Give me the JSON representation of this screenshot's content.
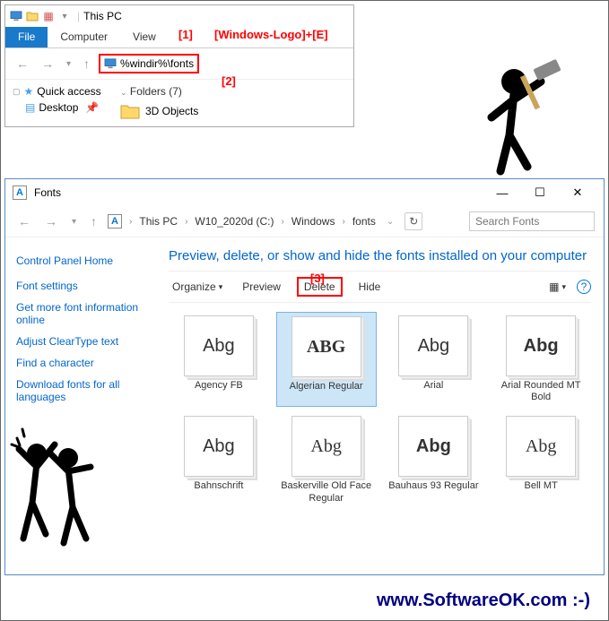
{
  "topWindow": {
    "title": "This PC",
    "fileTab": "File",
    "tabs": [
      "Computer",
      "View"
    ],
    "addressValue": "%windir%\\fonts",
    "quickAccess": "Quick access",
    "desktop": "Desktop",
    "foldersHeader": "Folders (7)",
    "folderItem": "3D Objects"
  },
  "annotations": {
    "a1_num": "[1]",
    "a1_text": "[Windows-Logo]+[E]",
    "a2": "[2]",
    "a3": "[3]"
  },
  "fontsWindow": {
    "title": "Fonts",
    "breadcrumb": [
      "This PC",
      "W10_2020d (C:)",
      "Windows",
      "fonts"
    ],
    "searchPlaceholder": "Search Fonts",
    "sidebar": {
      "home": "Control Panel Home",
      "links": [
        "Font settings",
        "Get more font information online",
        "Adjust ClearType text",
        "Find a character",
        "Download fonts for all languages"
      ]
    },
    "heading": "Preview, delete, or show and hide the fonts installed on your computer",
    "toolbar": {
      "organize": "Organize",
      "preview": "Preview",
      "delete": "Delete",
      "hide": "Hide"
    },
    "fonts": [
      {
        "name": "Agency FB",
        "sample": "Abg",
        "style": "font-family:'Agency FB',sans-serif;font-stretch:condensed"
      },
      {
        "name": "Algerian Regular",
        "sample": "ABG",
        "style": "font-family:'Algerian',serif;font-weight:bold",
        "selected": true
      },
      {
        "name": "Arial",
        "sample": "Abg",
        "style": "font-family:Arial,sans-serif"
      },
      {
        "name": "Arial Rounded MT Bold",
        "sample": "Abg",
        "style": "font-family:'Arial Rounded MT Bold',Arial,sans-serif;font-weight:bold"
      },
      {
        "name": "Bahnschrift",
        "sample": "Abg",
        "style": "font-family:Bahnschrift,sans-serif"
      },
      {
        "name": "Baskerville Old Face Regular",
        "sample": "Abg",
        "style": "font-family:'Baskerville Old Face',serif"
      },
      {
        "name": "Bauhaus 93 Regular",
        "sample": "Abg",
        "style": "font-family:'Bauhaus 93',sans-serif;font-weight:bold"
      },
      {
        "name": "Bell MT",
        "sample": "Abg",
        "style": "font-family:'Bell MT',serif"
      }
    ]
  },
  "footer": "www.SoftwareOK.com :-)",
  "watermark": "SoftwareOK.com"
}
